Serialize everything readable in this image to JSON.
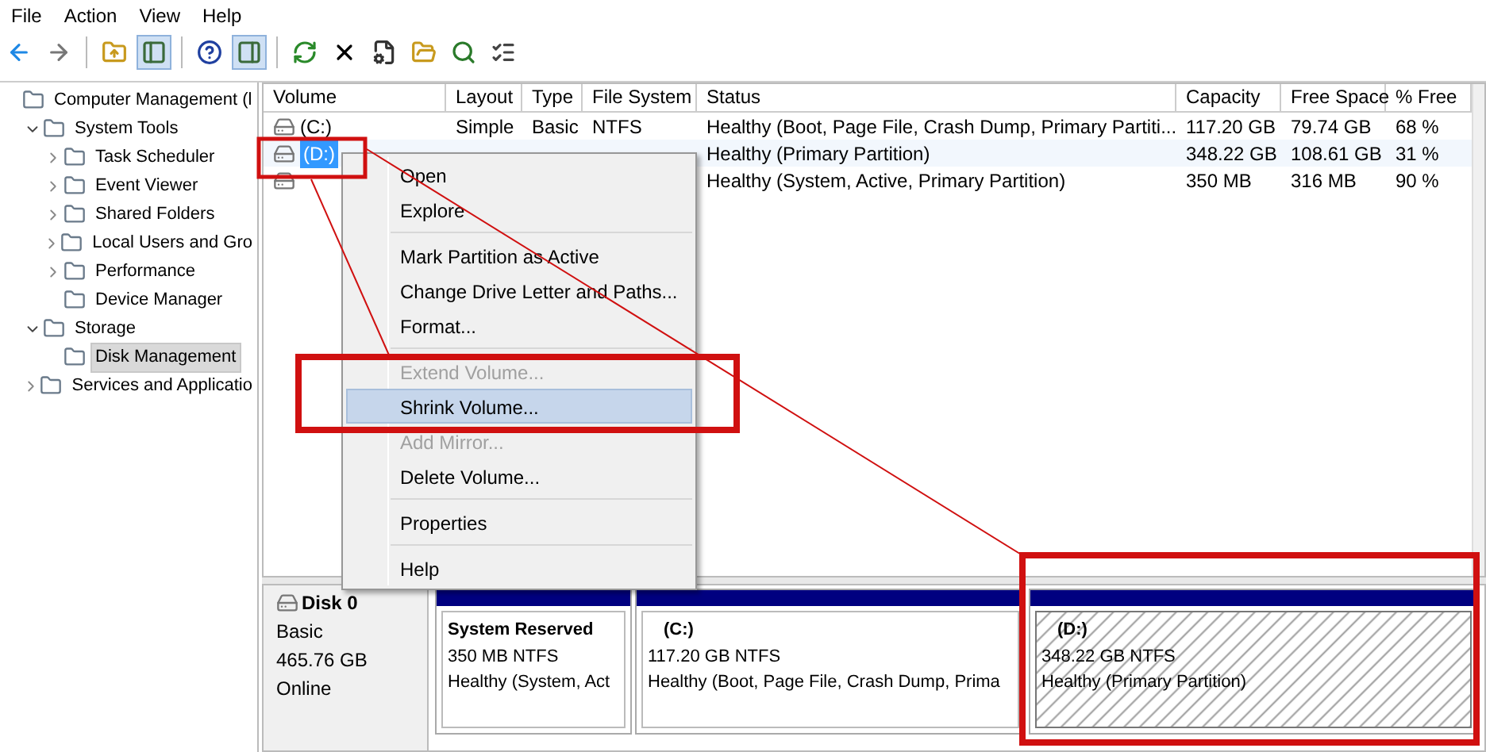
{
  "menu_bar": [
    "File",
    "Action",
    "View",
    "Help"
  ],
  "toolbar": [
    {
      "kind": "button",
      "pressed": false
    },
    {
      "kind": "button",
      "pressed": false
    },
    {
      "kind": "separator"
    },
    {
      "kind": "button",
      "pressed": false
    },
    {
      "kind": "button",
      "pressed": true
    },
    {
      "kind": "separator"
    },
    {
      "kind": "button",
      "pressed": false
    },
    {
      "kind": "button",
      "pressed": true
    },
    {
      "kind": "separator"
    },
    {
      "kind": "button",
      "pressed": false
    },
    {
      "kind": "button",
      "pressed": false
    },
    {
      "kind": "button",
      "pressed": false
    },
    {
      "kind": "button",
      "pressed": false
    },
    {
      "kind": "button",
      "pressed": false
    },
    {
      "kind": "button",
      "pressed": false
    }
  ],
  "tree": [
    {
      "label": "Computer Management (l",
      "selected": false,
      "children": [
        {
          "label": "System Tools",
          "selected": false,
          "expanded": true,
          "children": [
            {
              "label": "Task Scheduler",
              "selected": false,
              "expanded": false
            },
            {
              "label": "Event Viewer",
              "selected": false,
              "expanded": false
            },
            {
              "label": "Shared Folders",
              "selected": false,
              "expanded": false
            },
            {
              "label": "Local Users and Gro",
              "selected": false,
              "expanded": false
            },
            {
              "label": "Performance",
              "selected": false,
              "expanded": false
            },
            {
              "label": "Device Manager",
              "selected": false
            }
          ]
        },
        {
          "label": "Storage",
          "selected": false,
          "expanded": true,
          "children": [
            {
              "label": "Disk Management",
              "selected": true
            }
          ]
        },
        {
          "label": "Services and Applicatio",
          "selected": false,
          "expanded": false
        }
      ]
    }
  ],
  "table": {
    "columns": [
      "Volume",
      "Layout",
      "Type",
      "File System",
      "Status",
      "Capacity",
      "Free Space",
      "% Free"
    ],
    "rows": [
      {
        "selected": false,
        "cells": [
          "(C:)",
          "Simple",
          "Basic",
          "NTFS",
          "Healthy (Boot, Page File, Crash Dump, Primary Partiti...",
          "117.20 GB",
          "79.74 GB",
          "68 %"
        ]
      },
      {
        "selected": true,
        "cells": [
          "(D:)",
          null,
          null,
          null,
          "Healthy (Primary Partition)",
          "348.22 GB",
          "108.61 GB",
          "31 %"
        ]
      },
      {
        "selected": false,
        "cells": [
          null,
          null,
          null,
          null,
          "Healthy (System, Active, Primary Partition)",
          "350 MB",
          "316 MB",
          "90 %"
        ]
      }
    ]
  },
  "context_menu": [
    {
      "kind": "item",
      "label": "Open",
      "disabled": false,
      "selected": false
    },
    {
      "kind": "item",
      "label": "Explore",
      "disabled": false,
      "selected": false
    },
    {
      "kind": "separator"
    },
    {
      "kind": "item",
      "label": "Mark Partition as Active",
      "disabled": false,
      "selected": false
    },
    {
      "kind": "item",
      "label": "Change Drive Letter and Paths...",
      "disabled": false,
      "selected": false
    },
    {
      "kind": "item",
      "label": "Format...",
      "disabled": false,
      "selected": false
    },
    {
      "kind": "separator"
    },
    {
      "kind": "item",
      "label": "Extend Volume...",
      "disabled": true,
      "selected": false
    },
    {
      "kind": "item",
      "label": "Shrink Volume...",
      "disabled": false,
      "selected": true
    },
    {
      "kind": "item",
      "label": "Add Mirror...",
      "disabled": true,
      "selected": false
    },
    {
      "kind": "item",
      "label": "Delete Volume...",
      "disabled": false,
      "selected": false
    },
    {
      "kind": "separator"
    },
    {
      "kind": "item",
      "label": "Properties",
      "disabled": false,
      "selected": false
    },
    {
      "kind": "separator"
    },
    {
      "kind": "item",
      "label": "Help",
      "disabled": false,
      "selected": false
    }
  ],
  "disk": {
    "name": "Disk 0",
    "type": "Basic",
    "size": "465.76 GB",
    "status": "Online",
    "partitions": [
      {
        "name": "System Reserved",
        "detail": "350 MB NTFS",
        "status": "Healthy (System, Act",
        "selected": false
      },
      {
        "name": "(C:)",
        "detail": "117.20 GB NTFS",
        "status": "Healthy (Boot, Page File, Crash Dump, Prima",
        "selected": false
      },
      {
        "name": "(D:)",
        "detail": "348.22 GB NTFS",
        "status": "Healthy (Primary Partition)",
        "selected": true
      }
    ]
  }
}
